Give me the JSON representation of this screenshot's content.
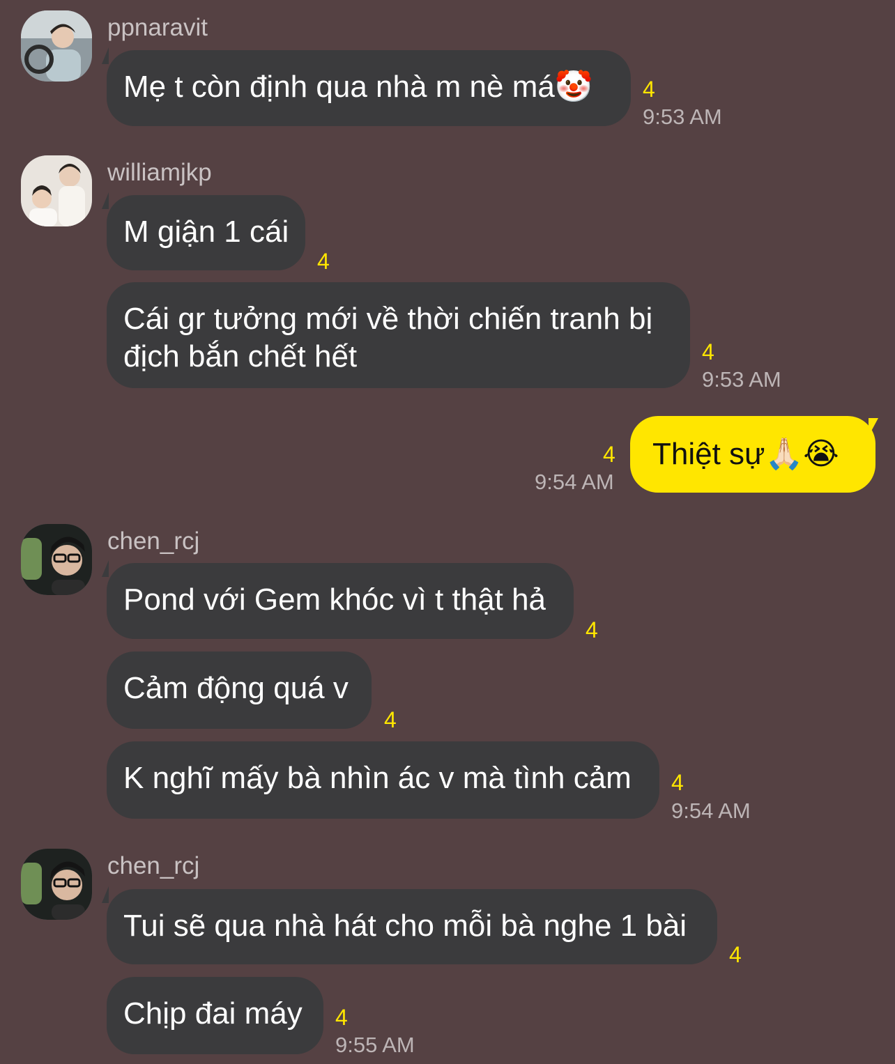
{
  "groups": [
    {
      "username": "ppnaravit",
      "messages": [
        {
          "text": "Mẹ t còn định qua nhà m nè má🤡",
          "read_count": "4",
          "time": "9:53 AM"
        }
      ]
    },
    {
      "username": "williamjkp",
      "messages": [
        {
          "text": "M giận 1 cái",
          "read_count": "4"
        },
        {
          "text": "Cái gr tưởng mới về thời chiến tranh bị địch bắn chết hết",
          "read_count": "4",
          "time": "9:53 AM"
        }
      ]
    },
    {
      "username": "chen_rcj",
      "messages": [
        {
          "text": "Pond với Gem khóc vì t thật hả",
          "read_count": "4"
        },
        {
          "text": "Cảm động quá v",
          "read_count": "4"
        },
        {
          "text": "K nghĩ mấy bà nhìn ác v mà tình cảm",
          "read_count": "4",
          "time": "9:54 AM"
        }
      ]
    },
    {
      "username": "chen_rcj",
      "messages": [
        {
          "text": "Tui sẽ qua nhà hát cho mỗi bà nghe 1 bài",
          "read_count": "4"
        },
        {
          "text": "Chịp đai máy",
          "read_count": "4",
          "time": "9:55 AM"
        }
      ]
    }
  ],
  "my_message": {
    "text": "Thiệt sự🙏🏻😭",
    "read_count": "4",
    "time": "9:54 AM"
  },
  "colors": {
    "background": "#554143",
    "incoming_bubble": "#3b3b3d",
    "outgoing_bubble": "#ffe600",
    "read_count": "#ffe600",
    "timestamp": "#bdb5b6"
  }
}
